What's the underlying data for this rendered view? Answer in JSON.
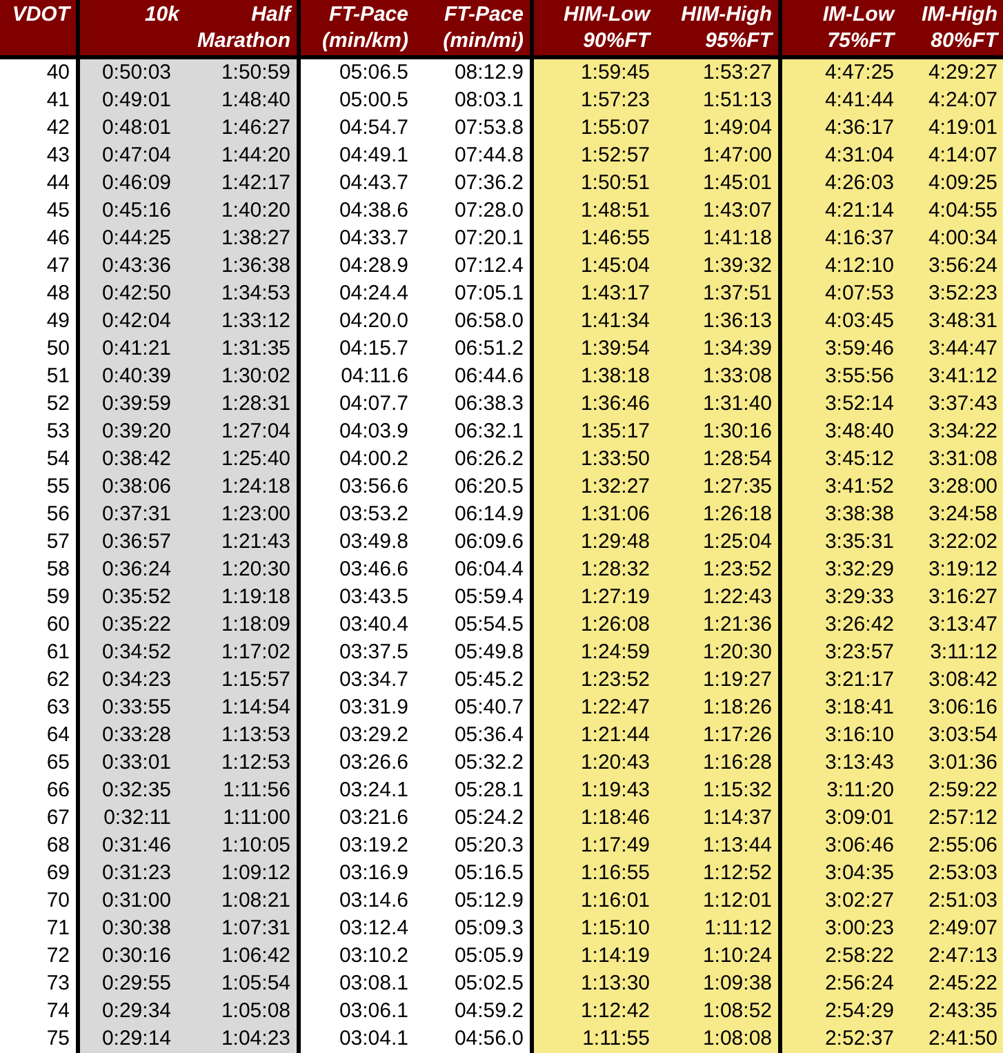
{
  "table": {
    "columns": [
      {
        "lines": [
          "VDOT"
        ],
        "kind": "plain",
        "divider_after": true
      },
      {
        "lines": [
          "10k"
        ],
        "kind": "gray",
        "divider_after": false
      },
      {
        "lines": [
          "Half",
          "Marathon"
        ],
        "kind": "gray",
        "divider_after": true
      },
      {
        "lines": [
          "FT-Pace",
          "(min/km)"
        ],
        "kind": "plain",
        "divider_after": false
      },
      {
        "lines": [
          "FT-Pace",
          "(min/mi)"
        ],
        "kind": "plain",
        "divider_after": true
      },
      {
        "lines": [
          "HIM-Low",
          "90%FT"
        ],
        "kind": "yellow",
        "divider_after": false
      },
      {
        "lines": [
          "HIM-High",
          "95%FT"
        ],
        "kind": "yellow",
        "divider_after": true
      },
      {
        "lines": [
          "IM-Low",
          "75%FT"
        ],
        "kind": "yellow",
        "divider_after": false
      },
      {
        "lines": [
          "IM-High",
          "80%FT"
        ],
        "kind": "yellow",
        "divider_after": false
      }
    ],
    "rows": [
      [
        "40",
        "0:50:03",
        "1:50:59",
        "05:06.5",
        "08:12.9",
        "1:59:45",
        "1:53:27",
        "4:47:25",
        "4:29:27"
      ],
      [
        "41",
        "0:49:01",
        "1:48:40",
        "05:00.5",
        "08:03.1",
        "1:57:23",
        "1:51:13",
        "4:41:44",
        "4:24:07"
      ],
      [
        "42",
        "0:48:01",
        "1:46:27",
        "04:54.7",
        "07:53.8",
        "1:55:07",
        "1:49:04",
        "4:36:17",
        "4:19:01"
      ],
      [
        "43",
        "0:47:04",
        "1:44:20",
        "04:49.1",
        "07:44.8",
        "1:52:57",
        "1:47:00",
        "4:31:04",
        "4:14:07"
      ],
      [
        "44",
        "0:46:09",
        "1:42:17",
        "04:43.7",
        "07:36.2",
        "1:50:51",
        "1:45:01",
        "4:26:03",
        "4:09:25"
      ],
      [
        "45",
        "0:45:16",
        "1:40:20",
        "04:38.6",
        "07:28.0",
        "1:48:51",
        "1:43:07",
        "4:21:14",
        "4:04:55"
      ],
      [
        "46",
        "0:44:25",
        "1:38:27",
        "04:33.7",
        "07:20.1",
        "1:46:55",
        "1:41:18",
        "4:16:37",
        "4:00:34"
      ],
      [
        "47",
        "0:43:36",
        "1:36:38",
        "04:28.9",
        "07:12.4",
        "1:45:04",
        "1:39:32",
        "4:12:10",
        "3:56:24"
      ],
      [
        "48",
        "0:42:50",
        "1:34:53",
        "04:24.4",
        "07:05.1",
        "1:43:17",
        "1:37:51",
        "4:07:53",
        "3:52:23"
      ],
      [
        "49",
        "0:42:04",
        "1:33:12",
        "04:20.0",
        "06:58.0",
        "1:41:34",
        "1:36:13",
        "4:03:45",
        "3:48:31"
      ],
      [
        "50",
        "0:41:21",
        "1:31:35",
        "04:15.7",
        "06:51.2",
        "1:39:54",
        "1:34:39",
        "3:59:46",
        "3:44:47"
      ],
      [
        "51",
        "0:40:39",
        "1:30:02",
        "04:11.6",
        "06:44.6",
        "1:38:18",
        "1:33:08",
        "3:55:56",
        "3:41:12"
      ],
      [
        "52",
        "0:39:59",
        "1:28:31",
        "04:07.7",
        "06:38.3",
        "1:36:46",
        "1:31:40",
        "3:52:14",
        "3:37:43"
      ],
      [
        "53",
        "0:39:20",
        "1:27:04",
        "04:03.9",
        "06:32.1",
        "1:35:17",
        "1:30:16",
        "3:48:40",
        "3:34:22"
      ],
      [
        "54",
        "0:38:42",
        "1:25:40",
        "04:00.2",
        "06:26.2",
        "1:33:50",
        "1:28:54",
        "3:45:12",
        "3:31:08"
      ],
      [
        "55",
        "0:38:06",
        "1:24:18",
        "03:56.6",
        "06:20.5",
        "1:32:27",
        "1:27:35",
        "3:41:52",
        "3:28:00"
      ],
      [
        "56",
        "0:37:31",
        "1:23:00",
        "03:53.2",
        "06:14.9",
        "1:31:06",
        "1:26:18",
        "3:38:38",
        "3:24:58"
      ],
      [
        "57",
        "0:36:57",
        "1:21:43",
        "03:49.8",
        "06:09.6",
        "1:29:48",
        "1:25:04",
        "3:35:31",
        "3:22:02"
      ],
      [
        "58",
        "0:36:24",
        "1:20:30",
        "03:46.6",
        "06:04.4",
        "1:28:32",
        "1:23:52",
        "3:32:29",
        "3:19:12"
      ],
      [
        "59",
        "0:35:52",
        "1:19:18",
        "03:43.5",
        "05:59.4",
        "1:27:19",
        "1:22:43",
        "3:29:33",
        "3:16:27"
      ],
      [
        "60",
        "0:35:22",
        "1:18:09",
        "03:40.4",
        "05:54.5",
        "1:26:08",
        "1:21:36",
        "3:26:42",
        "3:13:47"
      ],
      [
        "61",
        "0:34:52",
        "1:17:02",
        "03:37.5",
        "05:49.8",
        "1:24:59",
        "1:20:30",
        "3:23:57",
        "3:11:12"
      ],
      [
        "62",
        "0:34:23",
        "1:15:57",
        "03:34.7",
        "05:45.2",
        "1:23:52",
        "1:19:27",
        "3:21:17",
        "3:08:42"
      ],
      [
        "63",
        "0:33:55",
        "1:14:54",
        "03:31.9",
        "05:40.7",
        "1:22:47",
        "1:18:26",
        "3:18:41",
        "3:06:16"
      ],
      [
        "64",
        "0:33:28",
        "1:13:53",
        "03:29.2",
        "05:36.4",
        "1:21:44",
        "1:17:26",
        "3:16:10",
        "3:03:54"
      ],
      [
        "65",
        "0:33:01",
        "1:12:53",
        "03:26.6",
        "05:32.2",
        "1:20:43",
        "1:16:28",
        "3:13:43",
        "3:01:36"
      ],
      [
        "66",
        "0:32:35",
        "1:11:56",
        "03:24.1",
        "05:28.1",
        "1:19:43",
        "1:15:32",
        "3:11:20",
        "2:59:22"
      ],
      [
        "67",
        "0:32:11",
        "1:11:00",
        "03:21.6",
        "05:24.2",
        "1:18:46",
        "1:14:37",
        "3:09:01",
        "2:57:12"
      ],
      [
        "68",
        "0:31:46",
        "1:10:05",
        "03:19.2",
        "05:20.3",
        "1:17:49",
        "1:13:44",
        "3:06:46",
        "2:55:06"
      ],
      [
        "69",
        "0:31:23",
        "1:09:12",
        "03:16.9",
        "05:16.5",
        "1:16:55",
        "1:12:52",
        "3:04:35",
        "2:53:03"
      ],
      [
        "70",
        "0:31:00",
        "1:08:21",
        "03:14.6",
        "05:12.9",
        "1:16:01",
        "1:12:01",
        "3:02:27",
        "2:51:03"
      ],
      [
        "71",
        "0:30:38",
        "1:07:31",
        "03:12.4",
        "05:09.3",
        "1:15:10",
        "1:11:12",
        "3:00:23",
        "2:49:07"
      ],
      [
        "72",
        "0:30:16",
        "1:06:42",
        "03:10.2",
        "05:05.9",
        "1:14:19",
        "1:10:24",
        "2:58:22",
        "2:47:13"
      ],
      [
        "73",
        "0:29:55",
        "1:05:54",
        "03:08.1",
        "05:02.5",
        "1:13:30",
        "1:09:38",
        "2:56:24",
        "2:45:22"
      ],
      [
        "74",
        "0:29:34",
        "1:05:08",
        "03:06.1",
        "04:59.2",
        "1:12:42",
        "1:08:52",
        "2:54:29",
        "2:43:35"
      ],
      [
        "75",
        "0:29:14",
        "1:04:23",
        "03:04.1",
        "04:56.0",
        "1:11:55",
        "1:08:08",
        "2:52:37",
        "2:41:50"
      ]
    ]
  }
}
